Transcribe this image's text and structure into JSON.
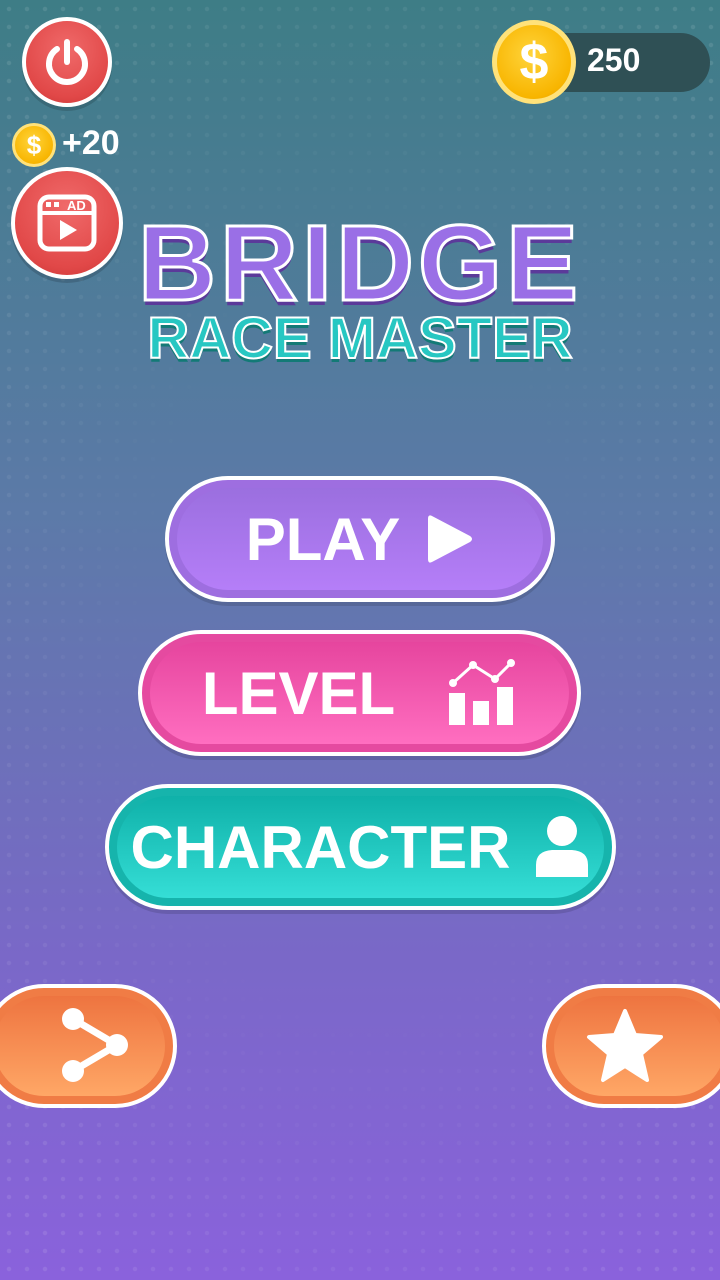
{
  "hud": {
    "coin_count": "250",
    "coin_symbol": "$",
    "bonus_amount": "+20",
    "ad_badge": "AD"
  },
  "title": {
    "main": "BRIDGE",
    "sub": "RACE MASTER"
  },
  "menu": {
    "play_label": "PLAY",
    "level_label": "LEVEL",
    "character_label": "CHARACTER"
  },
  "icons": {
    "power": "power-icon",
    "ad_video": "ad-video-icon",
    "coin": "coin-icon",
    "play": "play-triangle-icon",
    "level": "bar-chart-trend-icon",
    "character": "user-icon",
    "share": "share-icon",
    "rate": "star-icon"
  },
  "colors": {
    "power_button": "#e14848",
    "play_button": "#9e6ee0",
    "level_button": "#e54aa0",
    "character_button": "#16b4ac",
    "side_buttons": "#f07c45",
    "coin": "#f8b500"
  }
}
